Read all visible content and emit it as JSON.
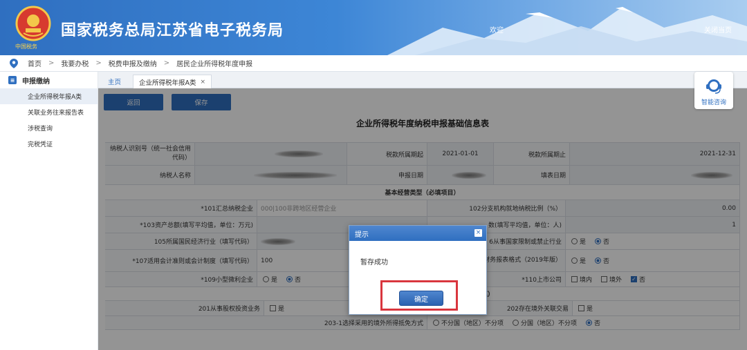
{
  "header": {
    "title": "国家税务总局江苏省电子税务局",
    "emblem_caption": "中国税务",
    "welcome": "欢迎",
    "close_current": "关闭当页"
  },
  "breadcrumb": [
    "首页",
    "我要办税",
    "税费申报及缴纳",
    "居民企业所得税年度申报"
  ],
  "sidebar": {
    "section": "申报缴纳",
    "items": [
      {
        "label": "企业所得税年报A类",
        "active": true
      },
      {
        "label": "关联业务往来报告表",
        "active": false
      },
      {
        "label": "涉税查询",
        "active": false
      },
      {
        "label": "完税凭证",
        "active": false
      }
    ]
  },
  "tabs": [
    {
      "label": "主页"
    },
    {
      "label": "企业所得税年报A类",
      "close": "×"
    }
  ],
  "toolbar": {
    "back": "返回",
    "save": "保存"
  },
  "assistant": {
    "label": "智能咨询"
  },
  "form": {
    "title": "企业所得税年度纳税申报基础信息表",
    "taxpayer_id_label": "纳税人识别号（统一社会信用代码）",
    "period_start_label": "税款所属期起",
    "period_start": "2021-01-01",
    "period_end_label": "税款所属期止",
    "period_end": "2021-12-31",
    "taxpayer_name_label": "纳税人名称",
    "report_date_label": "申报日期",
    "fill_date_label": "填表日期",
    "basic_section": "基本经营类型（必填项目）",
    "r101_label": "*101汇总纳税企业",
    "r101_value": "000|100非跨地区经营企业",
    "r102_label": "102分支机构就地纳税比例（%）",
    "r102_value": "0.00",
    "r103_label": "*103资产总额(填写平均值，单位：万元)",
    "r104_label": "数(填写平均值，单位：人)",
    "r104_value": "1",
    "r105_label": "105所属国民经济行业（填写代码）",
    "r106_label": "6从事国家限制或禁止行业",
    "r107_label": "*107适用会计准则或会计制度（填写代码）",
    "r107_value": "100",
    "r108_label": "业财务报表格式（2019年版）",
    "r109_label": "*109小型微利企业",
    "r110_label": "*110上市公司",
    "yes": "是",
    "no": "否",
    "domestic": "境内",
    "abroad": "境外",
    "related_section": "有关涉税事项情况（存在或者发生下列事项时必填）",
    "r201_label": "201从事股权投资业务",
    "r202_label": "202存在境外关联交易",
    "r203_label": "203-1选择采用的境外所得抵免方式",
    "r203_opt1": "不分国（地区）不分项",
    "r203_opt2": "分国（地区）不分项"
  },
  "dialog": {
    "title": "提示",
    "close": "×",
    "message": "暂存成功",
    "ok": "确定"
  },
  "colors": {
    "primary": "#2f6fc0",
    "highlight": "#d9363e",
    "overlay": "rgba(0,0,0,0.42)"
  }
}
